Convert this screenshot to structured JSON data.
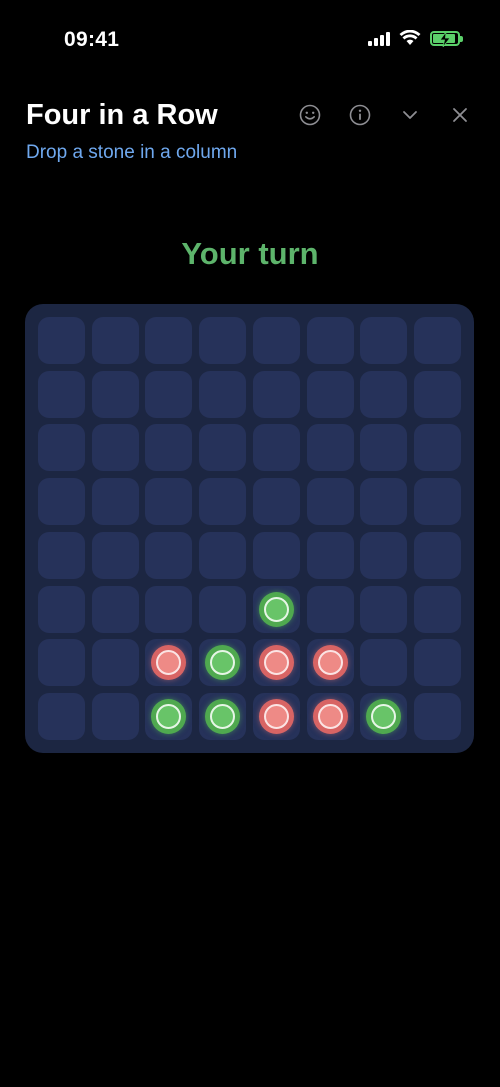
{
  "status_bar": {
    "time": "09:41"
  },
  "header": {
    "title": "Four in a Row",
    "subtitle": "Drop a stone in a column",
    "actions": [
      "smiley-icon",
      "info-icon",
      "chevron-down-icon",
      "close-icon"
    ]
  },
  "turn_label": "Your turn",
  "board": {
    "rows": 8,
    "columns": 8,
    "cells": [
      [
        null,
        null,
        null,
        null,
        null,
        null,
        null,
        null
      ],
      [
        null,
        null,
        null,
        null,
        null,
        null,
        null,
        null
      ],
      [
        null,
        null,
        null,
        null,
        null,
        null,
        null,
        null
      ],
      [
        null,
        null,
        null,
        null,
        null,
        null,
        null,
        null
      ],
      [
        null,
        null,
        null,
        null,
        null,
        null,
        null,
        null
      ],
      [
        null,
        null,
        null,
        null,
        "green",
        null,
        null,
        null
      ],
      [
        null,
        null,
        "red",
        "green",
        "red",
        "red",
        null,
        null
      ],
      [
        null,
        null,
        "green",
        "green",
        "red",
        "red",
        "green",
        null
      ]
    ]
  },
  "colors": {
    "background": "#000000",
    "subtitle": "#6fa8ee",
    "turn": "#5db46b",
    "board": "#1c2642",
    "cell": "#26325a",
    "green_stone": "#68c468",
    "red_stone": "#ee8a86"
  }
}
